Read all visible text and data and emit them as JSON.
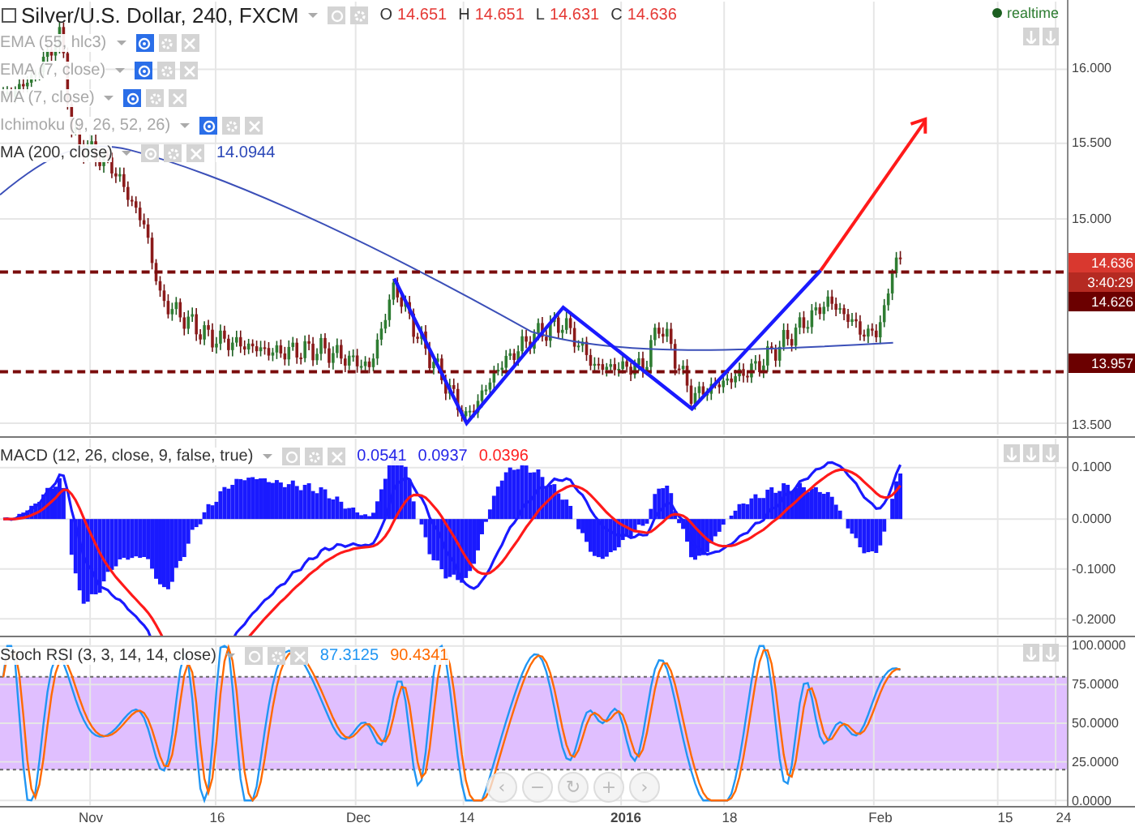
{
  "chart": {
    "title": "Silver/U.S. Dollar, 240, FXCM",
    "ohlc": [
      {
        "label": "O",
        "value": "14.651"
      },
      {
        "label": "H",
        "value": "14.651"
      },
      {
        "label": "L",
        "value": "14.631"
      },
      {
        "label": "C",
        "value": "14.636"
      }
    ],
    "status": "realtime",
    "indicators": [
      {
        "name": "EMA (55, hlc3)",
        "hidden": true
      },
      {
        "name": "EMA (7, close)",
        "hidden": true
      },
      {
        "name": "MA (7, close)",
        "hidden": true
      },
      {
        "name": "Ichimoku (9, 26, 52, 26)",
        "hidden": true
      },
      {
        "name": "MA (200, close)",
        "hidden": false,
        "value": "14.0944"
      }
    ],
    "price_axis": [
      "16.000",
      "15.500",
      "15.000",
      "13.500"
    ],
    "price_tags": [
      {
        "text": "14.636",
        "kind": "last"
      },
      {
        "text": "3:40:29",
        "kind": "countdown"
      },
      {
        "text": "14.626",
        "kind": "level"
      },
      {
        "text": "13.957",
        "kind": "level"
      }
    ]
  },
  "macd": {
    "title": "MACD (12, 26, close, 9, false, true)",
    "values": [
      {
        "text": "0.0541",
        "color": "#2424e8"
      },
      {
        "text": "0.0937",
        "color": "#2424e8"
      },
      {
        "text": "0.0396",
        "color": "#ff2020"
      }
    ],
    "axis": [
      "0.1000",
      "0.0000",
      "-0.1000",
      "-0.2000"
    ]
  },
  "stoch_rsi": {
    "title": "Stoch RSI (3, 3, 14, 14, close)",
    "values": [
      {
        "text": "87.3125",
        "color": "#2196f3"
      },
      {
        "text": "90.4341",
        "color": "#ff6a00"
      }
    ],
    "axis": [
      "100.0000",
      "75.0000",
      "50.0000",
      "25.0000",
      "0.0000"
    ]
  },
  "nav_buttons": [
    "‹",
    "−",
    "↻",
    "+",
    "›"
  ],
  "time_axis": [
    {
      "label": "Nov",
      "bold": false
    },
    {
      "label": "16",
      "bold": false
    },
    {
      "label": "Dec",
      "bold": false
    },
    {
      "label": "14",
      "bold": false
    },
    {
      "label": "2016",
      "bold": true
    },
    {
      "label": "18",
      "bold": false
    },
    {
      "label": "Feb",
      "bold": false
    },
    {
      "label": "15",
      "bold": false
    },
    {
      "label": "24",
      "bold": false
    }
  ]
}
